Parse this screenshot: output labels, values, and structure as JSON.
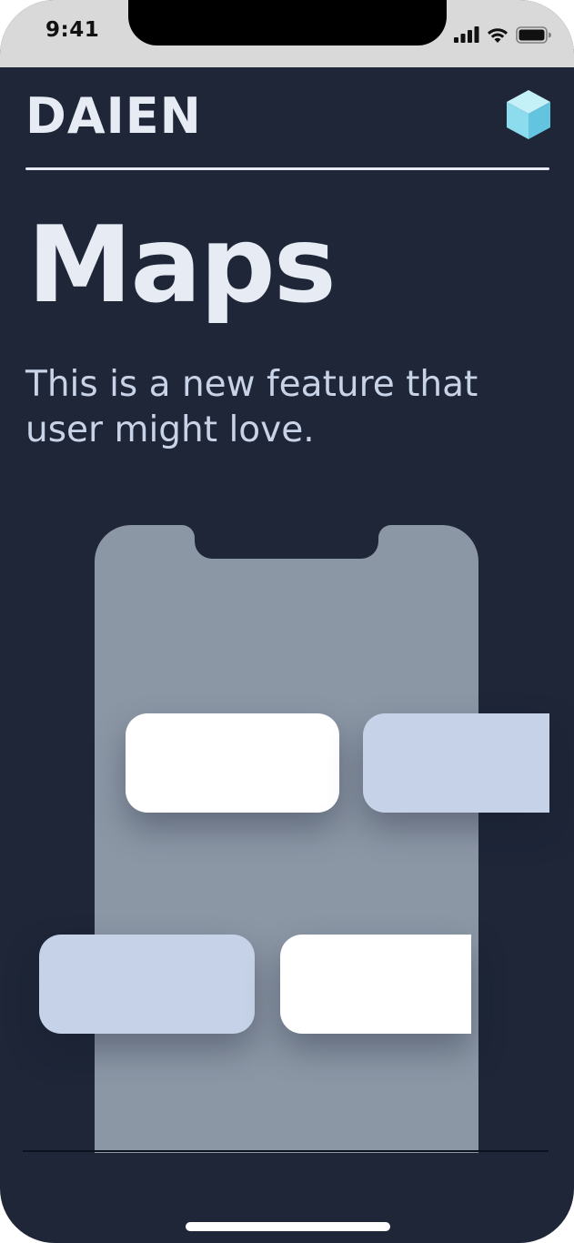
{
  "status_bar": {
    "time": "9:41",
    "icons": [
      "signal-icon",
      "wifi-icon",
      "battery-icon"
    ]
  },
  "header": {
    "brand": "DAIEN",
    "logo_icon": "cube-icon"
  },
  "main": {
    "title": "Maps",
    "subtitle": "This is a new feature that user might love."
  },
  "colors": {
    "background": "#1e2638",
    "text_primary": "#e6ebf4",
    "text_secondary": "#c8d3e8",
    "mock_phone": "#8c97a6",
    "card_white": "#ffffff",
    "card_blue": "#c5d2e8",
    "logo_accent": "#7fd4e8"
  }
}
